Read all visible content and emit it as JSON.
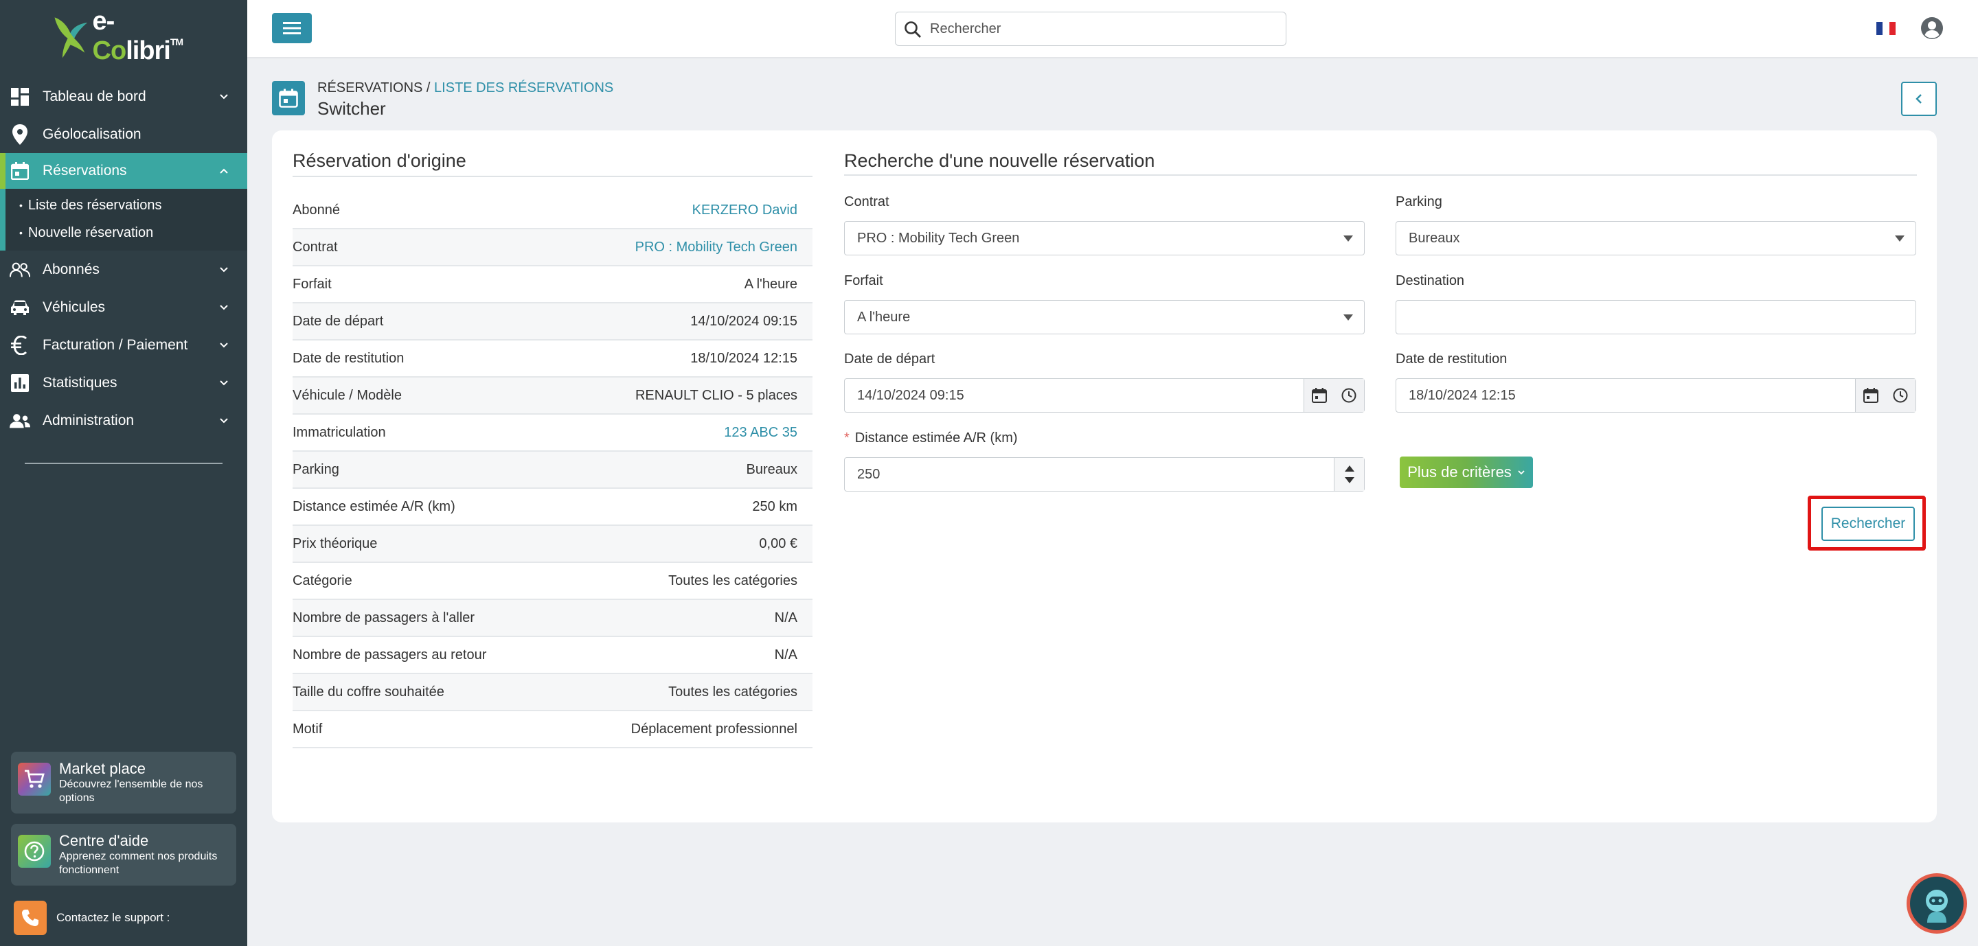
{
  "brand": {
    "name_prefix": "e-",
    "name_co": "Co",
    "name_suffix": "libri",
    "tm": "TM"
  },
  "sidebar": {
    "items": [
      {
        "label": "Tableau de bord"
      },
      {
        "label": "Géolocalisation"
      },
      {
        "label": "Réservations"
      },
      {
        "label": "Abonnés"
      },
      {
        "label": "Véhicules"
      },
      {
        "label": "Facturation / Paiement"
      },
      {
        "label": "Statistiques"
      },
      {
        "label": "Administration"
      }
    ],
    "subitems": [
      {
        "label": "Liste des réservations"
      },
      {
        "label": "Nouvelle réservation"
      }
    ],
    "promos": [
      {
        "title": "Market place",
        "desc": "Découvrez l'ensemble de nos options"
      },
      {
        "title": "Centre d'aide",
        "desc": "Apprenez comment nos produits fonctionnent"
      }
    ],
    "support": "Contactez le support :"
  },
  "topbar": {
    "search_placeholder": "Rechercher"
  },
  "page": {
    "breadcrumb_root": "RÉSERVATIONS /",
    "breadcrumb_link": "LISTE DES RÉSERVATIONS",
    "title": "Switcher"
  },
  "origin": {
    "title": "Réservation d'origine",
    "rows": [
      {
        "label": "Abonné",
        "value": "KERZERO David",
        "link": true
      },
      {
        "label": "Contrat",
        "value": "PRO : Mobility Tech Green",
        "link": true
      },
      {
        "label": "Forfait",
        "value": "A l'heure",
        "link": false
      },
      {
        "label": "Date de départ",
        "value": "14/10/2024 09:15",
        "link": false
      },
      {
        "label": "Date de restitution",
        "value": "18/10/2024 12:15",
        "link": false
      },
      {
        "label": "Véhicule / Modèle",
        "value": "RENAULT CLIO - 5 places",
        "link": false
      },
      {
        "label": "Immatriculation",
        "value": "123 ABC 35",
        "link": true
      },
      {
        "label": "Parking",
        "value": "Bureaux",
        "link": false
      },
      {
        "label": "Distance estimée A/R (km)",
        "value": "250 km",
        "link": false
      },
      {
        "label": "Prix théorique",
        "value": "0,00 €",
        "link": false
      },
      {
        "label": "Catégorie",
        "value": "Toutes les catégories",
        "link": false
      },
      {
        "label": "Nombre de passagers à l'aller",
        "value": "N/A",
        "link": false
      },
      {
        "label": "Nombre de passagers au retour",
        "value": "N/A",
        "link": false
      },
      {
        "label": "Taille du coffre souhaitée",
        "value": "Toutes les catégories",
        "link": false
      },
      {
        "label": "Motif",
        "value": "Déplacement professionnel",
        "link": false
      }
    ]
  },
  "search_form": {
    "title": "Recherche d'une nouvelle réservation",
    "contrat": {
      "label": "Contrat",
      "value": "PRO : Mobility Tech Green"
    },
    "parking": {
      "label": "Parking",
      "value": "Bureaux"
    },
    "forfait": {
      "label": "Forfait",
      "value": "A l'heure"
    },
    "destination": {
      "label": "Destination",
      "value": ""
    },
    "depart": {
      "label": "Date de départ",
      "value": "14/10/2024 09:15"
    },
    "restitution": {
      "label": "Date de restitution",
      "value": "18/10/2024 12:15"
    },
    "distance": {
      "required": "*",
      "label": "Distance estimée A/R (km)",
      "value": "250"
    },
    "more_button": "Plus de critères",
    "search_button": "Rechercher"
  },
  "colors": {
    "primary": "#2e8fa8",
    "accent_green": "#8cc43f",
    "sidebar": "#2f3e45",
    "highlight": "#e01414"
  }
}
